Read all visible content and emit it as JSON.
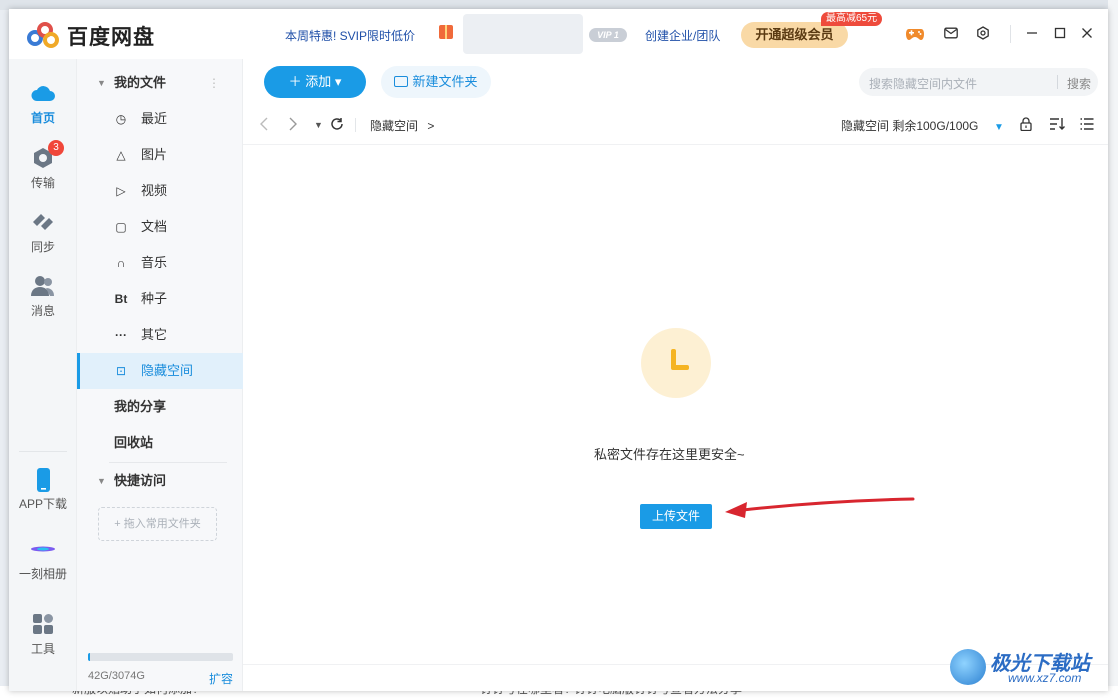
{
  "app": {
    "name": "百度网盘",
    "promo": "本周特惠! SVIP限时低价",
    "vip_badge": "VIP 1",
    "create_team": "创建企业/团队",
    "vip_button": "开通超级会员",
    "vip_tag": "最高减65元"
  },
  "sidebar": {
    "items": [
      {
        "label": "首页",
        "icon": "cloud-icon"
      },
      {
        "label": "传输",
        "icon": "transfer-icon",
        "badge": "3"
      },
      {
        "label": "同步",
        "icon": "sync-icon"
      },
      {
        "label": "消息",
        "icon": "people-icon"
      },
      {
        "label": "APP下载",
        "icon": "phone-icon"
      },
      {
        "label": "一刻相册",
        "icon": "album-icon"
      },
      {
        "label": "工具",
        "icon": "tools-icon"
      }
    ]
  },
  "nav": {
    "my_files": "我的文件",
    "items": [
      {
        "label": "最近",
        "icon": "clock-icon",
        "glyph": "◷"
      },
      {
        "label": "图片",
        "icon": "mountain-icon",
        "glyph": "△"
      },
      {
        "label": "视频",
        "icon": "play-icon",
        "glyph": "▷"
      },
      {
        "label": "文档",
        "icon": "document-icon",
        "glyph": "▢"
      },
      {
        "label": "音乐",
        "icon": "headphones-icon",
        "glyph": "∩"
      },
      {
        "label": "种子",
        "icon": "bt-icon",
        "glyph": "Bt"
      },
      {
        "label": "其它",
        "icon": "more-icon",
        "glyph": "···"
      },
      {
        "label": "隐藏空间",
        "icon": "lock-icon",
        "glyph": "⊡"
      }
    ],
    "my_share": "我的分享",
    "recycle": "回收站",
    "quick_access": "快捷访问",
    "drop_zone": "+ 拖入常用文件夹",
    "quota_text": "42G/3074G",
    "quota_fraction": 0.014,
    "expand": "扩容"
  },
  "toolbar": {
    "add": "＋ 添加 ▾",
    "new_folder": "新建文件夹",
    "search_placeholder": "搜索隐藏空间内文件",
    "search_button": "搜索"
  },
  "breadcrumb": {
    "current": "隐藏空间",
    "separator": ">"
  },
  "hidden_space": {
    "info": "隐藏空间 剩余100G/100G"
  },
  "empty_state": {
    "message": "私密文件存在这里更安全~",
    "upload_button": "上传文件"
  },
  "watermark": {
    "title": "极光下载站",
    "url": "www.xz7.com"
  },
  "background_text": {
    "left": "新服以贴助手如何添加?",
    "middle": "钉钉号在哪里看? 钉钉电脑版钉钉号查看方法分享"
  },
  "colors": {
    "accent": "#1a9be6",
    "vip_gold": "#f9d9a6",
    "badge_red": "#f0473a",
    "arrow_red": "#d8262f"
  }
}
